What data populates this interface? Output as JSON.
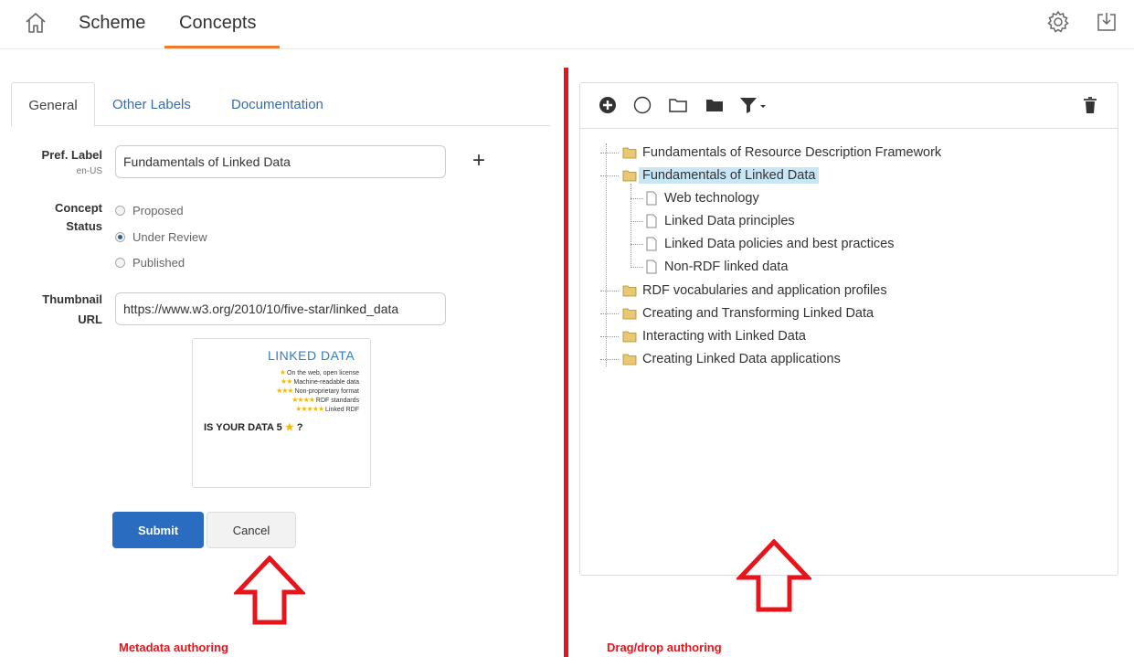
{
  "nav": {
    "tabs": [
      {
        "label": "Scheme"
      },
      {
        "label": "Concepts",
        "active": true
      }
    ],
    "home_icon": "home-icon",
    "settings_icon": "gear-icon",
    "download_icon": "download-icon",
    "accent_color": "#f07a2a"
  },
  "form": {
    "tabs": [
      {
        "label": "General",
        "active": true
      },
      {
        "label": "Other Labels"
      },
      {
        "label": "Documentation"
      }
    ],
    "pref_label": {
      "label": "Pref. Label",
      "lang": "en-US",
      "value": "Fundamentals of Linked Data"
    },
    "status": {
      "label_line1": "Concept",
      "label_line2": "Status",
      "options": [
        "Proposed",
        "Under Review",
        "Published"
      ],
      "selected": "Under Review"
    },
    "thumbnail": {
      "label_line1": "Thumbnail",
      "label_line2": "URL",
      "value": "https://www.w3.org/2010/10/five-star/linked_data"
    },
    "thumbnail_image": {
      "title": "LINKED DATA",
      "lines": [
        {
          "stars": "★",
          "text": "On the web, open license"
        },
        {
          "stars": "★★",
          "text": "Machine-readable data"
        },
        {
          "stars": "★★★",
          "text": "Non-proprietary format"
        },
        {
          "stars": "★★★★",
          "text": "RDF standards"
        },
        {
          "stars": "★★★★★",
          "text": "Linked RDF"
        }
      ],
      "bottom_text": "IS YOUR DATA 5",
      "bottom_star": "★",
      "bottom_suffix": "?"
    },
    "submit_label": "Submit",
    "cancel_label": "Cancel",
    "primary_color": "#2a6cc0"
  },
  "tree": {
    "toolbar_icons": [
      "add-circle-icon",
      "circle-icon",
      "folder-outline-icon",
      "folder-icon",
      "filter-icon",
      "trash-icon"
    ],
    "nodes": [
      {
        "label": "Fundamentals of Resource Description Framework",
        "type": "folder",
        "level": 0
      },
      {
        "label": "Fundamentals of Linked Data",
        "type": "folder",
        "level": 0,
        "selected": true
      },
      {
        "label": "Web technology",
        "type": "file",
        "level": 1
      },
      {
        "label": "Linked Data principles",
        "type": "file",
        "level": 1
      },
      {
        "label": "Linked Data policies and best practices",
        "type": "file",
        "level": 1
      },
      {
        "label": "Non-RDF linked data",
        "type": "file",
        "level": 1
      },
      {
        "label": "RDF vocabularies and application profiles",
        "type": "folder",
        "level": 0
      },
      {
        "label": "Creating and Transforming Linked Data",
        "type": "folder",
        "level": 0
      },
      {
        "label": "Interacting with Linked Data",
        "type": "folder",
        "level": 0
      },
      {
        "label": "Creating Linked Data applications",
        "type": "folder",
        "level": 0
      }
    ],
    "selection_color": "#c9e6f7"
  },
  "annotations": {
    "left": "Metadata authoring",
    "right": "Drag/drop authoring",
    "color": "#e8141b"
  }
}
